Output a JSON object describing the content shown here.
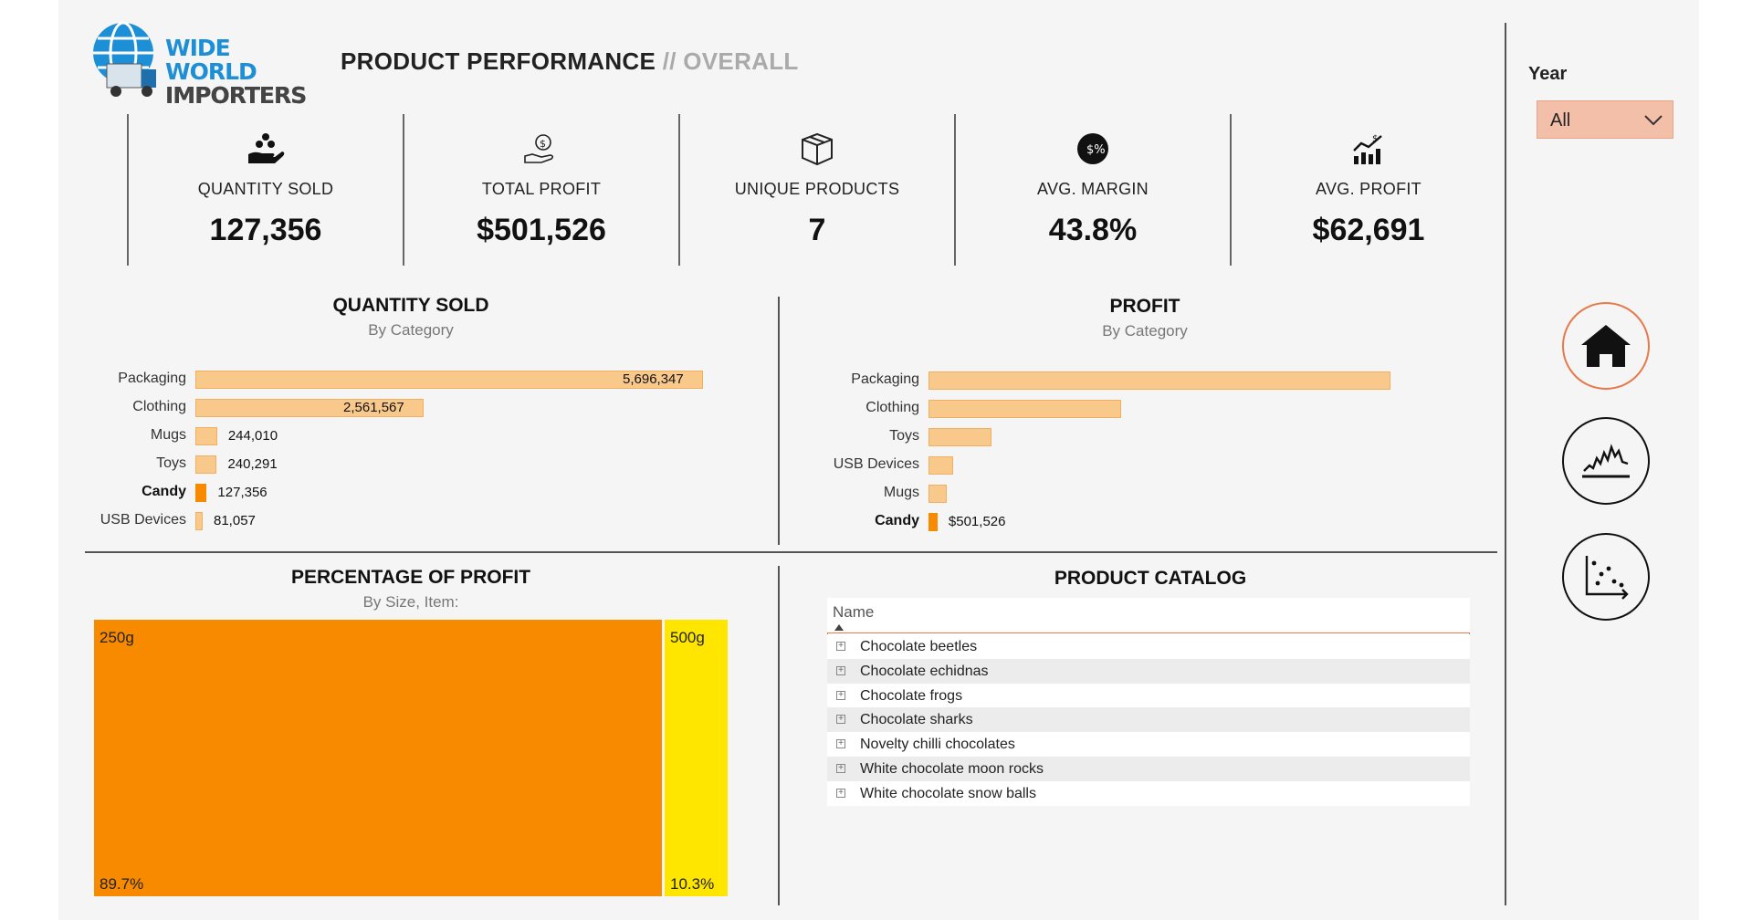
{
  "header": {
    "logo_line1": "WIDE WORLD",
    "logo_line2": "IMPORTERS",
    "title": "PRODUCT PERFORMANCE",
    "title_suffix": "// OVERALL"
  },
  "kpis": [
    {
      "icon": "hand-coins-icon",
      "label": "QUANTITY SOLD",
      "value": "127,356"
    },
    {
      "icon": "dollar-hand-icon",
      "label": "TOTAL PROFIT",
      "value": "$501,526"
    },
    {
      "icon": "box-icon",
      "label": "UNIQUE PRODUCTS",
      "value": "7"
    },
    {
      "icon": "margin-icon",
      "label": "AVG. MARGIN",
      "value": "43.8%"
    },
    {
      "icon": "profit-chart-icon",
      "label": "AVG. PROFIT",
      "value": "$62,691"
    }
  ],
  "filter": {
    "label": "Year",
    "value": "All"
  },
  "quantity_chart": {
    "title": "QUANTITY SOLD",
    "subtitle": "By Category",
    "chart_data": {
      "type": "bar",
      "categories": [
        "Packaging",
        "Clothing",
        "Mugs",
        "Toys",
        "Candy",
        "USB Devices"
      ],
      "values": [
        5696347,
        2561567,
        244010,
        240291,
        127356,
        81057
      ],
      "labels": [
        "5,696,347",
        "2,561,567",
        "244,010",
        "240,291",
        "127,356",
        "81,057"
      ],
      "highlight": "Candy"
    }
  },
  "profit_chart": {
    "title": "PROFIT",
    "subtitle": "By Category",
    "chart_data": {
      "type": "bar",
      "categories": [
        "Packaging",
        "Clothing",
        "Toys",
        "USB Devices",
        "Mugs",
        "Candy"
      ],
      "values": [
        25600000,
        10700000,
        3500000,
        1380000,
        1000000,
        501526
      ],
      "labels": [
        "",
        "",
        "",
        "",
        "",
        "$501,526"
      ],
      "highlight": "Candy"
    }
  },
  "treemap": {
    "title": "PERCENTAGE OF PROFIT",
    "subtitle": "By Size, Item:",
    "chart_data": {
      "type": "treemap",
      "items": [
        {
          "name": "250g",
          "value": 89.7,
          "label": "89.7%",
          "color": "#f88a00"
        },
        {
          "name": "500g",
          "value": 10.3,
          "label": "10.3%",
          "color": "#ffe600"
        }
      ]
    }
  },
  "catalog": {
    "title": "PRODUCT CATALOG",
    "column": "Name",
    "rows": [
      "Chocolate beetles",
      "Chocolate echidnas",
      "Chocolate frogs",
      "Chocolate sharks",
      "Novelty chilli chocolates",
      "White chocolate moon rocks",
      "White chocolate snow balls"
    ]
  },
  "nav": [
    {
      "icon": "home-icon"
    },
    {
      "icon": "line-chart-icon"
    },
    {
      "icon": "scatter-chart-icon"
    }
  ],
  "colors": {
    "accent": "#f88a00",
    "bar": "#f9c98b",
    "yellow": "#ffe600",
    "filter_bg": "#f4bfa9",
    "nav_active": "#e57a4a"
  }
}
